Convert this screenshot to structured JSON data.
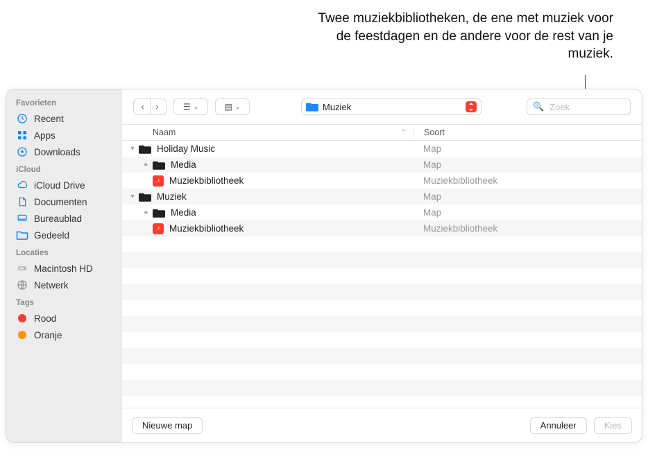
{
  "annotation": "Twee muziekbibliotheken, de ene met muziek voor de feestdagen en de andere voor de rest van je muziek.",
  "sidebar": {
    "sections": [
      {
        "title": "Favorieten",
        "items": [
          {
            "icon": "clock-icon",
            "label": "Recent"
          },
          {
            "icon": "app-grid-icon",
            "label": "Apps"
          },
          {
            "icon": "download-icon",
            "label": "Downloads"
          }
        ]
      },
      {
        "title": "iCloud",
        "items": [
          {
            "icon": "cloud-icon",
            "label": "iCloud Drive"
          },
          {
            "icon": "document-icon",
            "label": "Documenten"
          },
          {
            "icon": "desktop-icon",
            "label": "Bureaublad"
          },
          {
            "icon": "shared-folder-icon",
            "label": "Gedeeld"
          }
        ]
      },
      {
        "title": "Locaties",
        "items": [
          {
            "icon": "harddrive-icon",
            "label": "Macintosh HD"
          },
          {
            "icon": "globe-icon",
            "label": "Netwerk"
          }
        ]
      },
      {
        "title": "Tags",
        "items": [
          {
            "icon": "tag-dot",
            "color": "#ff3b30",
            "label": "Rood"
          },
          {
            "icon": "tag-dot",
            "color": "#ff9500",
            "label": "Oranje"
          }
        ]
      }
    ]
  },
  "toolbar": {
    "location_label": "Muziek",
    "search_placeholder": "Zoek"
  },
  "columns": {
    "name": "Naam",
    "kind": "Soort"
  },
  "rows": [
    {
      "indent": 0,
      "disclosure": "down",
      "icon": "folder",
      "name": "Holiday Music",
      "kind": "Map"
    },
    {
      "indent": 1,
      "disclosure": "right",
      "icon": "folder",
      "name": "Media",
      "kind": "Map"
    },
    {
      "indent": 1,
      "disclosure": "none",
      "icon": "musiclib",
      "name": "Muziekbibliotheek",
      "kind": "Muziekbibliotheek"
    },
    {
      "indent": 0,
      "disclosure": "down",
      "icon": "folder",
      "name": "Muziek",
      "kind": "Map"
    },
    {
      "indent": 1,
      "disclosure": "right",
      "icon": "folder",
      "name": "Media",
      "kind": "Map"
    },
    {
      "indent": 1,
      "disclosure": "none",
      "icon": "musiclib",
      "name": "Muziekbibliotheek",
      "kind": "Muziekbibliotheek"
    }
  ],
  "footer": {
    "new_folder": "Nieuwe map",
    "cancel": "Annuleer",
    "choose": "Kies"
  }
}
